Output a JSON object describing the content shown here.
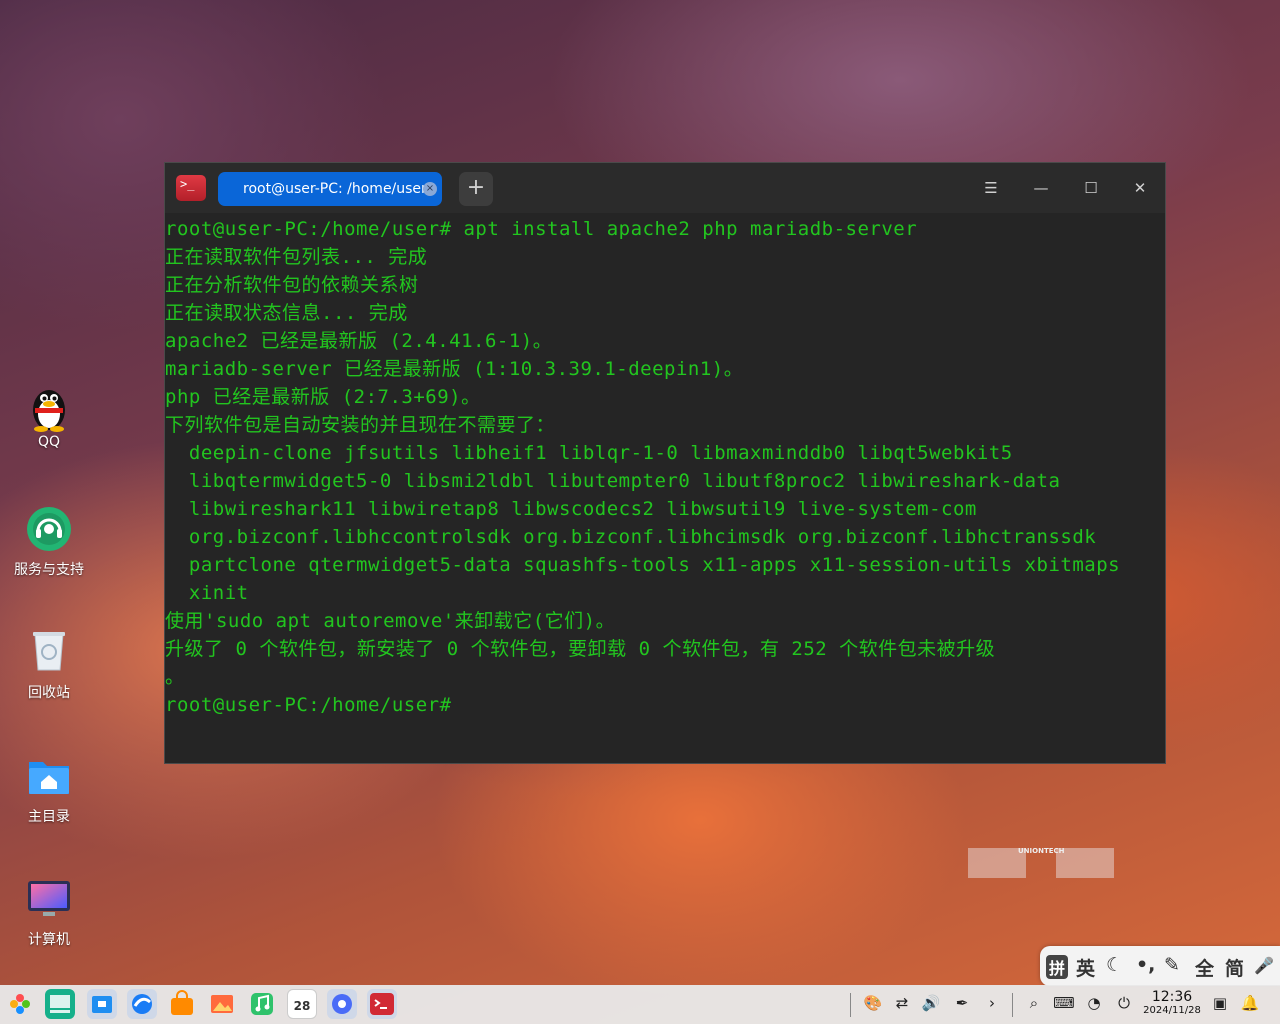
{
  "desktop": {
    "icons": [
      {
        "label": "QQ"
      },
      {
        "label": "服务与支持"
      },
      {
        "label": "回收站"
      },
      {
        "label": "主目录"
      },
      {
        "label": "计算机"
      }
    ],
    "watermark": "UNIONTECH"
  },
  "terminal": {
    "tab_title": "root@user-PC: /home/user",
    "tab_close": "×",
    "new_tab": "+",
    "app_icon": ">_",
    "lines": [
      "root@user-PC:/home/user# apt install apache2 php mariadb-server",
      "正在读取软件包列表... 完成",
      "正在分析软件包的依赖关系树",
      "正在读取状态信息... 完成",
      "apache2 已经是最新版 (2.4.41.6-1)。",
      "mariadb-server 已经是最新版 (1:10.3.39.1-deepin1)。",
      "php 已经是最新版 (2:7.3+69)。",
      "下列软件包是自动安装的并且现在不需要了：",
      "  deepin-clone jfsutils libheif1 liblqr-1-0 libmaxminddb0 libqt5webkit5",
      "  libqtermwidget5-0 libsmi2ldbl libutempter0 libutf8proc2 libwireshark-data",
      "  libwireshark11 libwiretap8 libwscodecs2 libwsutil9 live-system-com",
      "  org.bizconf.libhccontrolsdk org.bizconf.libhcimsdk org.bizconf.libhctranssdk",
      "  partclone qtermwidget5-data squashfs-tools x11-apps x11-session-utils xbitmaps",
      "  xinit",
      "使用'sudo apt autoremove'来卸载它(它们)。",
      "升级了 0 个软件包，新安装了 0 个软件包，要卸载 0 个软件包，有 252 个软件包未被升级",
      "。",
      "root@user-PC:/home/user#"
    ]
  },
  "ime": {
    "items": [
      "拼",
      "英",
      "☾",
      "•,",
      "✎",
      "全",
      "简",
      "🎤"
    ]
  },
  "taskbar": {
    "calendar_day": "28",
    "clock_time": "12:36",
    "clock_date": "2024/11/28"
  },
  "colors": {
    "terminal_text": "#22c51f",
    "terminal_bg": "#252525",
    "tab_active": "#0a66d8"
  }
}
